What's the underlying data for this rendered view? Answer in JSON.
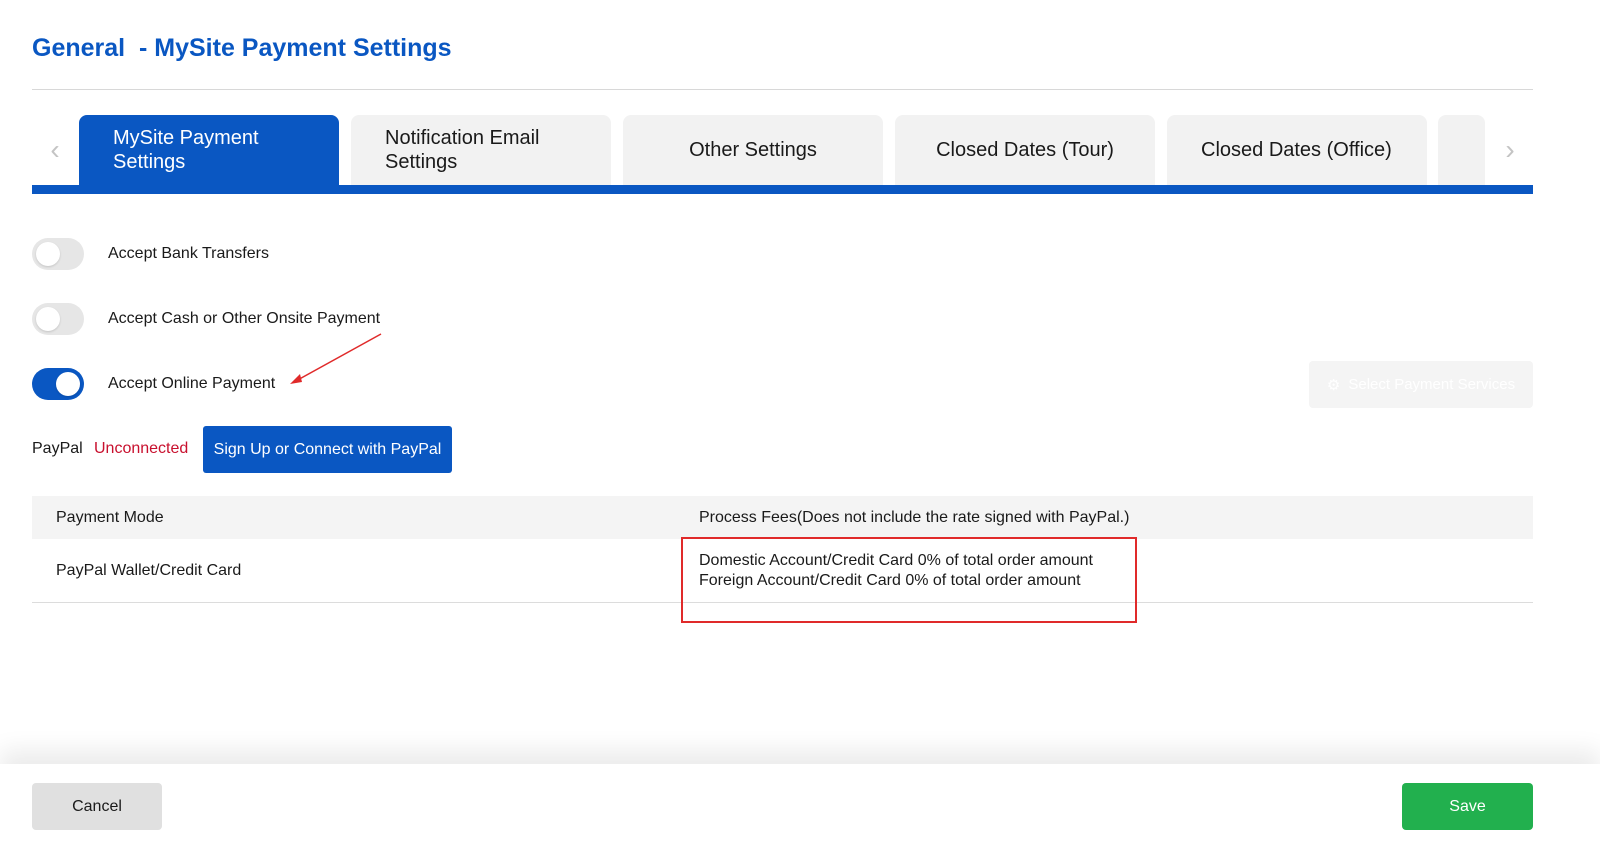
{
  "header": {
    "title": "General  - MySite Payment Settings"
  },
  "tabs": [
    {
      "label": "MySite Payment Settings",
      "active": true
    },
    {
      "label": "Notification Email Settings",
      "active": false
    },
    {
      "label": "Other Settings",
      "active": false
    },
    {
      "label": "Closed Dates (Tour)",
      "active": false
    },
    {
      "label": "Closed Dates (Office)",
      "active": false
    }
  ],
  "tab_nav": {
    "prev": "‹",
    "next": "›"
  },
  "toggles": [
    {
      "label": "Accept Bank Transfers",
      "on": false
    },
    {
      "label": "Accept Cash or Other Onsite Payment",
      "on": false
    },
    {
      "label": "Accept Online Payment",
      "on": true
    }
  ],
  "select_services": {
    "label": "Select Payment Services",
    "icon": "gear-icon"
  },
  "paypal": {
    "label": "PayPal",
    "status": "Unconnected",
    "connect_button": "Sign Up or Connect with PayPal"
  },
  "table": {
    "headers": [
      "Payment Mode",
      "Process Fees(Does not include the rate signed with PayPal.)"
    ],
    "rows": [
      {
        "mode": "PayPal Wallet/Credit Card",
        "fees": [
          "Domestic Account/Credit Card 0% of total order amount",
          "Foreign Account/Credit Card 0% of total order amount"
        ]
      }
    ]
  },
  "footer": {
    "cancel": "Cancel",
    "save": "Save"
  },
  "colors": {
    "primary": "#0a57c2",
    "save": "#22b04e",
    "unconnected": "#c8102e",
    "annotation": "#e02a2a"
  }
}
